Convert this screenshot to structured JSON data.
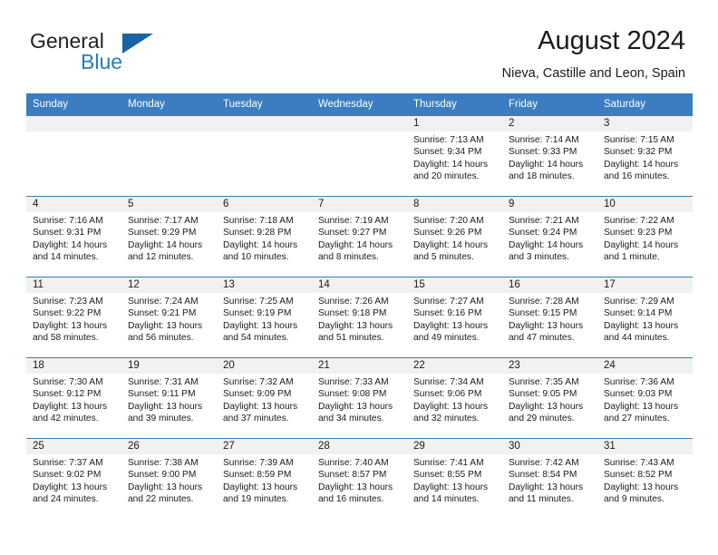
{
  "brand": {
    "line1": "General",
    "line2": "Blue",
    "flag_color": "#1763a5",
    "blue_color": "#1f7fc4"
  },
  "header": {
    "title": "August 2024",
    "subtitle": "Nieva, Castille and Leon, Spain"
  },
  "theme": {
    "header_blue": "#3b7dc0",
    "daynum_band": "#f1f1f1",
    "text": "#1a1a1a"
  },
  "weekday_headers": [
    "Sunday",
    "Monday",
    "Tuesday",
    "Wednesday",
    "Thursday",
    "Friday",
    "Saturday"
  ],
  "weeks": [
    [
      {
        "day": "",
        "sunrise": "",
        "sunset": "",
        "daylight_line1": "",
        "daylight_line2": "",
        "empty": true
      },
      {
        "day": "",
        "sunrise": "",
        "sunset": "",
        "daylight_line1": "",
        "daylight_line2": "",
        "empty": true
      },
      {
        "day": "",
        "sunrise": "",
        "sunset": "",
        "daylight_line1": "",
        "daylight_line2": "",
        "empty": true
      },
      {
        "day": "",
        "sunrise": "",
        "sunset": "",
        "daylight_line1": "",
        "daylight_line2": "",
        "empty": true
      },
      {
        "day": "1",
        "sunrise": "Sunrise: 7:13 AM",
        "sunset": "Sunset: 9:34 PM",
        "daylight_line1": "Daylight: 14 hours",
        "daylight_line2": "and 20 minutes."
      },
      {
        "day": "2",
        "sunrise": "Sunrise: 7:14 AM",
        "sunset": "Sunset: 9:33 PM",
        "daylight_line1": "Daylight: 14 hours",
        "daylight_line2": "and 18 minutes."
      },
      {
        "day": "3",
        "sunrise": "Sunrise: 7:15 AM",
        "sunset": "Sunset: 9:32 PM",
        "daylight_line1": "Daylight: 14 hours",
        "daylight_line2": "and 16 minutes."
      }
    ],
    [
      {
        "day": "4",
        "sunrise": "Sunrise: 7:16 AM",
        "sunset": "Sunset: 9:31 PM",
        "daylight_line1": "Daylight: 14 hours",
        "daylight_line2": "and 14 minutes."
      },
      {
        "day": "5",
        "sunrise": "Sunrise: 7:17 AM",
        "sunset": "Sunset: 9:29 PM",
        "daylight_line1": "Daylight: 14 hours",
        "daylight_line2": "and 12 minutes."
      },
      {
        "day": "6",
        "sunrise": "Sunrise: 7:18 AM",
        "sunset": "Sunset: 9:28 PM",
        "daylight_line1": "Daylight: 14 hours",
        "daylight_line2": "and 10 minutes."
      },
      {
        "day": "7",
        "sunrise": "Sunrise: 7:19 AM",
        "sunset": "Sunset: 9:27 PM",
        "daylight_line1": "Daylight: 14 hours",
        "daylight_line2": "and 8 minutes."
      },
      {
        "day": "8",
        "sunrise": "Sunrise: 7:20 AM",
        "sunset": "Sunset: 9:26 PM",
        "daylight_line1": "Daylight: 14 hours",
        "daylight_line2": "and 5 minutes."
      },
      {
        "day": "9",
        "sunrise": "Sunrise: 7:21 AM",
        "sunset": "Sunset: 9:24 PM",
        "daylight_line1": "Daylight: 14 hours",
        "daylight_line2": "and 3 minutes."
      },
      {
        "day": "10",
        "sunrise": "Sunrise: 7:22 AM",
        "sunset": "Sunset: 9:23 PM",
        "daylight_line1": "Daylight: 14 hours",
        "daylight_line2": "and 1 minute."
      }
    ],
    [
      {
        "day": "11",
        "sunrise": "Sunrise: 7:23 AM",
        "sunset": "Sunset: 9:22 PM",
        "daylight_line1": "Daylight: 13 hours",
        "daylight_line2": "and 58 minutes."
      },
      {
        "day": "12",
        "sunrise": "Sunrise: 7:24 AM",
        "sunset": "Sunset: 9:21 PM",
        "daylight_line1": "Daylight: 13 hours",
        "daylight_line2": "and 56 minutes."
      },
      {
        "day": "13",
        "sunrise": "Sunrise: 7:25 AM",
        "sunset": "Sunset: 9:19 PM",
        "daylight_line1": "Daylight: 13 hours",
        "daylight_line2": "and 54 minutes."
      },
      {
        "day": "14",
        "sunrise": "Sunrise: 7:26 AM",
        "sunset": "Sunset: 9:18 PM",
        "daylight_line1": "Daylight: 13 hours",
        "daylight_line2": "and 51 minutes."
      },
      {
        "day": "15",
        "sunrise": "Sunrise: 7:27 AM",
        "sunset": "Sunset: 9:16 PM",
        "daylight_line1": "Daylight: 13 hours",
        "daylight_line2": "and 49 minutes."
      },
      {
        "day": "16",
        "sunrise": "Sunrise: 7:28 AM",
        "sunset": "Sunset: 9:15 PM",
        "daylight_line1": "Daylight: 13 hours",
        "daylight_line2": "and 47 minutes."
      },
      {
        "day": "17",
        "sunrise": "Sunrise: 7:29 AM",
        "sunset": "Sunset: 9:14 PM",
        "daylight_line1": "Daylight: 13 hours",
        "daylight_line2": "and 44 minutes."
      }
    ],
    [
      {
        "day": "18",
        "sunrise": "Sunrise: 7:30 AM",
        "sunset": "Sunset: 9:12 PM",
        "daylight_line1": "Daylight: 13 hours",
        "daylight_line2": "and 42 minutes."
      },
      {
        "day": "19",
        "sunrise": "Sunrise: 7:31 AM",
        "sunset": "Sunset: 9:11 PM",
        "daylight_line1": "Daylight: 13 hours",
        "daylight_line2": "and 39 minutes."
      },
      {
        "day": "20",
        "sunrise": "Sunrise: 7:32 AM",
        "sunset": "Sunset: 9:09 PM",
        "daylight_line1": "Daylight: 13 hours",
        "daylight_line2": "and 37 minutes."
      },
      {
        "day": "21",
        "sunrise": "Sunrise: 7:33 AM",
        "sunset": "Sunset: 9:08 PM",
        "daylight_line1": "Daylight: 13 hours",
        "daylight_line2": "and 34 minutes."
      },
      {
        "day": "22",
        "sunrise": "Sunrise: 7:34 AM",
        "sunset": "Sunset: 9:06 PM",
        "daylight_line1": "Daylight: 13 hours",
        "daylight_line2": "and 32 minutes."
      },
      {
        "day": "23",
        "sunrise": "Sunrise: 7:35 AM",
        "sunset": "Sunset: 9:05 PM",
        "daylight_line1": "Daylight: 13 hours",
        "daylight_line2": "and 29 minutes."
      },
      {
        "day": "24",
        "sunrise": "Sunrise: 7:36 AM",
        "sunset": "Sunset: 9:03 PM",
        "daylight_line1": "Daylight: 13 hours",
        "daylight_line2": "and 27 minutes."
      }
    ],
    [
      {
        "day": "25",
        "sunrise": "Sunrise: 7:37 AM",
        "sunset": "Sunset: 9:02 PM",
        "daylight_line1": "Daylight: 13 hours",
        "daylight_line2": "and 24 minutes."
      },
      {
        "day": "26",
        "sunrise": "Sunrise: 7:38 AM",
        "sunset": "Sunset: 9:00 PM",
        "daylight_line1": "Daylight: 13 hours",
        "daylight_line2": "and 22 minutes."
      },
      {
        "day": "27",
        "sunrise": "Sunrise: 7:39 AM",
        "sunset": "Sunset: 8:59 PM",
        "daylight_line1": "Daylight: 13 hours",
        "daylight_line2": "and 19 minutes."
      },
      {
        "day": "28",
        "sunrise": "Sunrise: 7:40 AM",
        "sunset": "Sunset: 8:57 PM",
        "daylight_line1": "Daylight: 13 hours",
        "daylight_line2": "and 16 minutes."
      },
      {
        "day": "29",
        "sunrise": "Sunrise: 7:41 AM",
        "sunset": "Sunset: 8:55 PM",
        "daylight_line1": "Daylight: 13 hours",
        "daylight_line2": "and 14 minutes."
      },
      {
        "day": "30",
        "sunrise": "Sunrise: 7:42 AM",
        "sunset": "Sunset: 8:54 PM",
        "daylight_line1": "Daylight: 13 hours",
        "daylight_line2": "and 11 minutes."
      },
      {
        "day": "31",
        "sunrise": "Sunrise: 7:43 AM",
        "sunset": "Sunset: 8:52 PM",
        "daylight_line1": "Daylight: 13 hours",
        "daylight_line2": "and 9 minutes."
      }
    ]
  ]
}
